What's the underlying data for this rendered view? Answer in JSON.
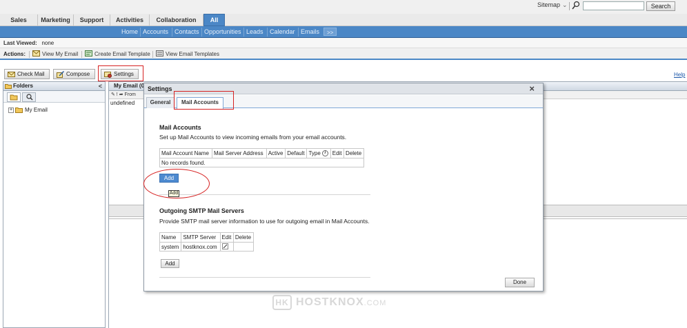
{
  "topbar": {
    "sitemap_label": "Sitemap",
    "search_placeholder": "",
    "search_button": "Search"
  },
  "module_tabs": [
    "Sales",
    "Marketing",
    "Support",
    "Activities",
    "Collaboration",
    "All"
  ],
  "active_module": "All",
  "subnav": [
    "Home",
    "Accounts",
    "Contacts",
    "Opportunities",
    "Leads",
    "Calendar",
    "Emails",
    ">>"
  ],
  "last_viewed": {
    "label": "Last Viewed:",
    "value": "none"
  },
  "actions": {
    "label": "Actions:",
    "items": [
      "View My Email",
      "Create Email Template",
      "View Email Templates"
    ]
  },
  "toolbar": {
    "check_mail": "Check Mail",
    "compose": "Compose",
    "settings": "Settings",
    "help": "Help"
  },
  "folders": {
    "title": "Folders",
    "collapse": "<",
    "tree": [
      {
        "label": "My Email",
        "expander": "+"
      }
    ]
  },
  "email_panel": {
    "title": "My Email (0",
    "columns_fragment": "From",
    "first_row": "undefined"
  },
  "dialog": {
    "title": "Settings",
    "close": "×",
    "tabs": [
      "General",
      "Mail Accounts"
    ],
    "active_tab": "Mail Accounts",
    "mail_accounts": {
      "heading": "Mail Accounts",
      "description": "Set up Mail Accounts to view incoming emails from your email accounts.",
      "columns": [
        "Mail Account Name",
        "Mail Server Address",
        "Active",
        "Default",
        "Type",
        "Edit",
        "Delete"
      ],
      "empty_text": "No records found.",
      "add_label": "Add",
      "tooltip": "Add"
    },
    "smtp": {
      "heading": "Outgoing SMTP Mail Servers",
      "description": "Provide SMTP mail server information to use for outgoing email in Mail Accounts.",
      "columns": [
        "Name",
        "SMTP Server",
        "Edit",
        "Delete"
      ],
      "rows": [
        {
          "name": "system",
          "server": "hostknox.com",
          "edit": "",
          "delete": ""
        }
      ],
      "add_label": "Add"
    },
    "done_label": "Done"
  },
  "watermark": {
    "logo": "HK",
    "text": "HOSTKNOX",
    "suffix": ".COM"
  },
  "colors": {
    "accent": "#4b87c6",
    "highlight_red": "#d62020"
  }
}
